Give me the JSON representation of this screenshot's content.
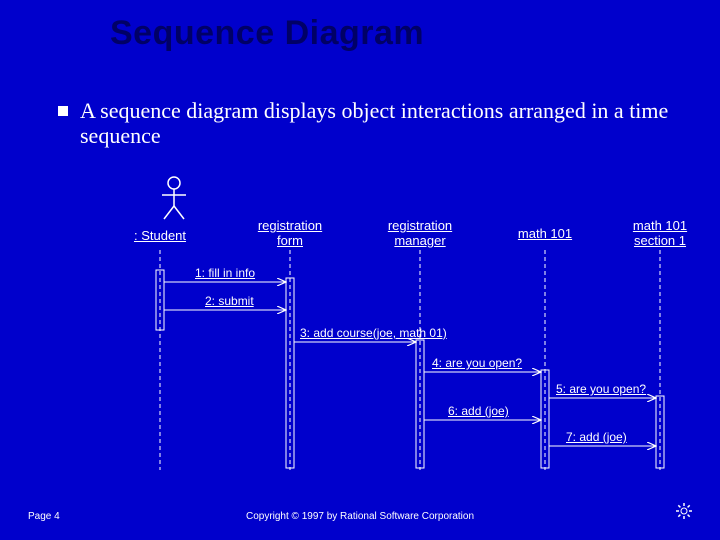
{
  "title": "Sequence Diagram",
  "bullet": "A sequence diagram displays object interactions arranged in a time sequence",
  "participants": {
    "p1": ": Student",
    "p2": "registration\nform",
    "p3": "registration\nmanager",
    "p4": "math 101",
    "p5": "math 101\nsection 1"
  },
  "messages": {
    "m1": "1: fill in info",
    "m2": "2: submit",
    "m3": "3: add course(joe, math 01)",
    "m4": "4: are you open?",
    "m5": "5: are you open?",
    "m6": "6: add (joe)",
    "m7": "7: add (joe)"
  },
  "footer": {
    "page": "Page 4",
    "copyright": "Copyright © 1997 by Rational Software Corporation"
  },
  "layout": {
    "x": {
      "p1": 160,
      "p2": 290,
      "p3": 420,
      "p4": 545,
      "p5": 660
    },
    "lifetop": 80,
    "lifebottom": 300
  }
}
